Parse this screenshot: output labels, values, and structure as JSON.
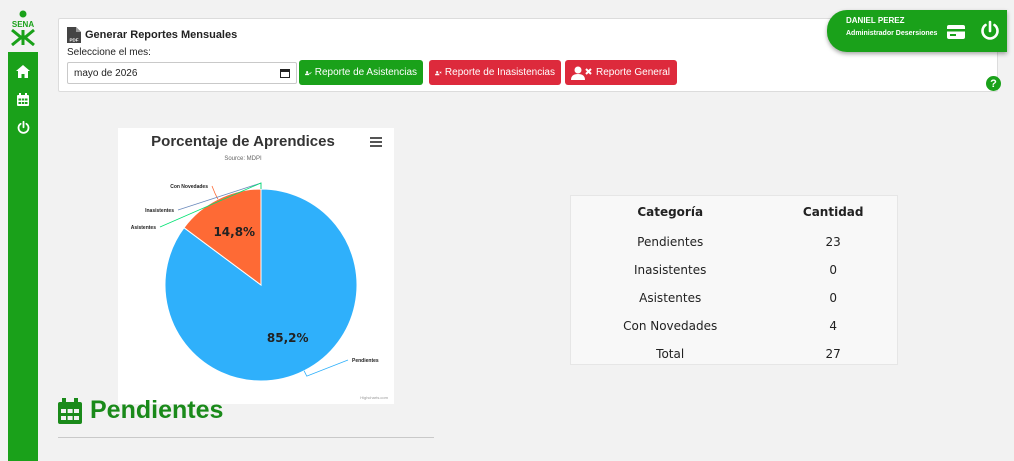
{
  "brand": {
    "logo_text": "SENA",
    "accent": "#1aa11a",
    "danger": "#dd2a3c"
  },
  "sidebar": {
    "items": [
      {
        "icon": "home-icon"
      },
      {
        "icon": "calendar-icon"
      },
      {
        "icon": "power-icon"
      }
    ]
  },
  "report_panel": {
    "title": "Generar Reportes Mensuales",
    "subtitle": "Seleccione el mes:",
    "month_value": "mayo de 2026",
    "buttons": {
      "asistencias": "Reporte de Asistencias",
      "inasistencias": "Reporte de Inasistencias",
      "general": "Reporte General"
    }
  },
  "user": {
    "name": "DANIEL PEREZ",
    "role": "Administrador Desersiones"
  },
  "help_label": "?",
  "chart_data": {
    "type": "pie",
    "title": "Porcentaje de Aprendices",
    "subtitle": "Source: MDPI",
    "credits": "Highcharts.com",
    "slices": [
      {
        "name": "Pendientes",
        "value": 23,
        "label": "85,2%",
        "color": "#2fb0fb"
      },
      {
        "name": "Con Novedades",
        "value": 4,
        "label": "14,8%",
        "color": "#fe6a35"
      },
      {
        "name": "Inasistentes",
        "value": 0,
        "color": "#6b8abc"
      },
      {
        "name": "Asistentes",
        "value": 0,
        "color": "#00e272"
      }
    ]
  },
  "table": {
    "headers": [
      "Categoría",
      "Cantidad"
    ],
    "rows": [
      [
        "Pendientes",
        "23"
      ],
      [
        "Inasistentes",
        "0"
      ],
      [
        "Asistentes",
        "0"
      ],
      [
        "Con Novedades",
        "4"
      ],
      [
        "Total",
        "27"
      ]
    ]
  },
  "section": {
    "title": "Pendientes"
  }
}
